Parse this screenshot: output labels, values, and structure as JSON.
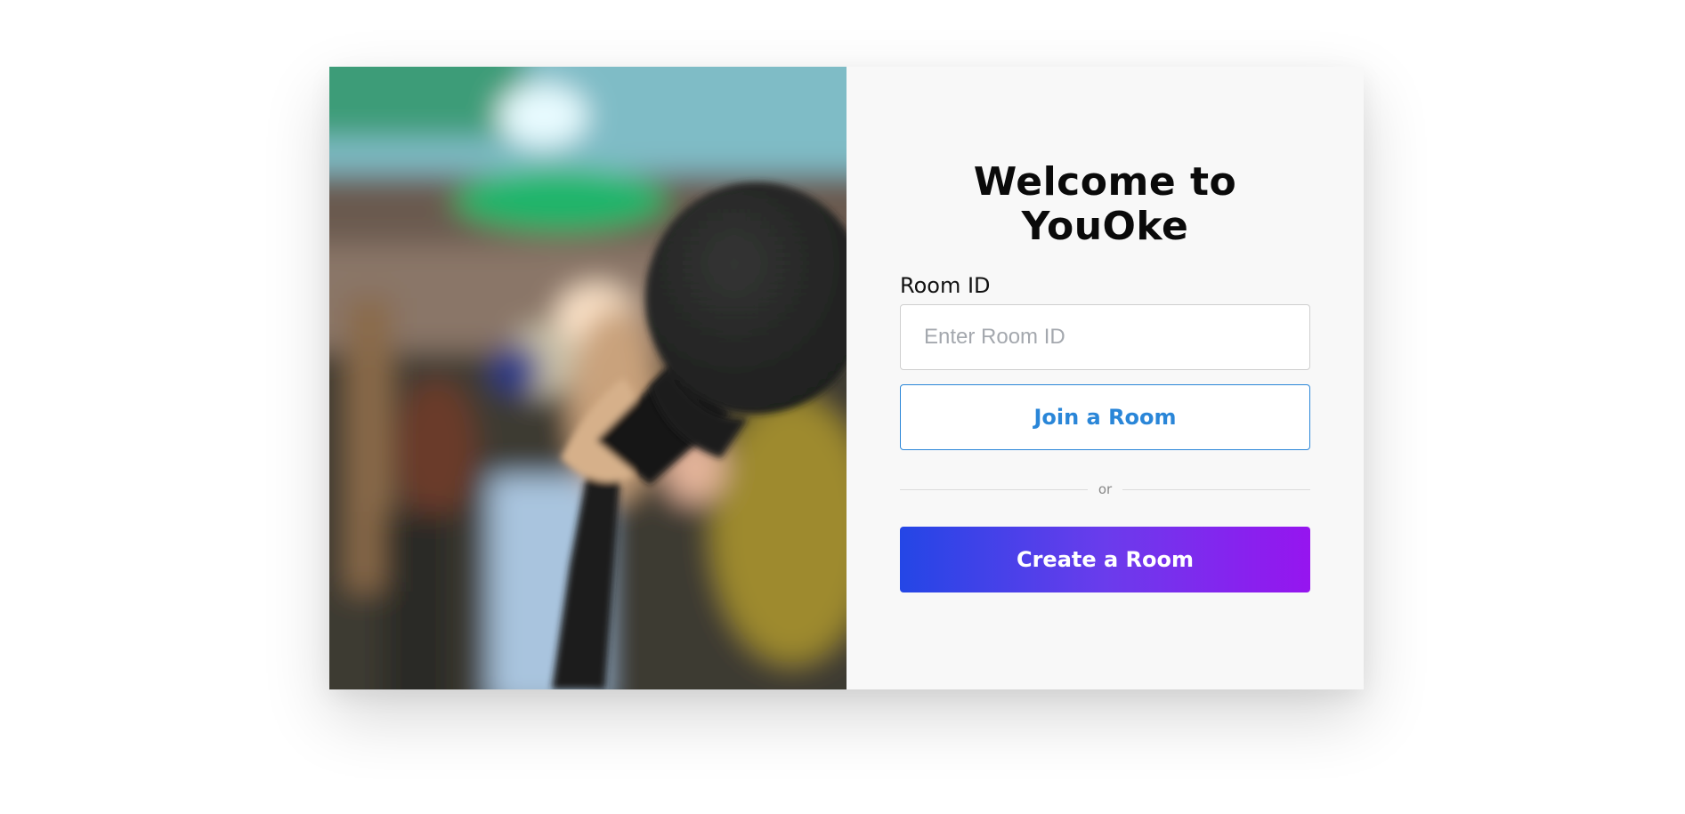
{
  "welcome": {
    "title_line1": "Welcome to",
    "title_line2": "YouOke"
  },
  "room_form": {
    "room_id_label": "Room ID",
    "room_id_value": "",
    "room_id_placeholder": "Enter Room ID",
    "join_label": "Join a Room",
    "divider_text": "or",
    "create_label": "Create a Room"
  },
  "colors": {
    "join_accent": "#2a86d8",
    "create_gradient_start": "#2446e6",
    "create_gradient_end": "#9615ef"
  }
}
